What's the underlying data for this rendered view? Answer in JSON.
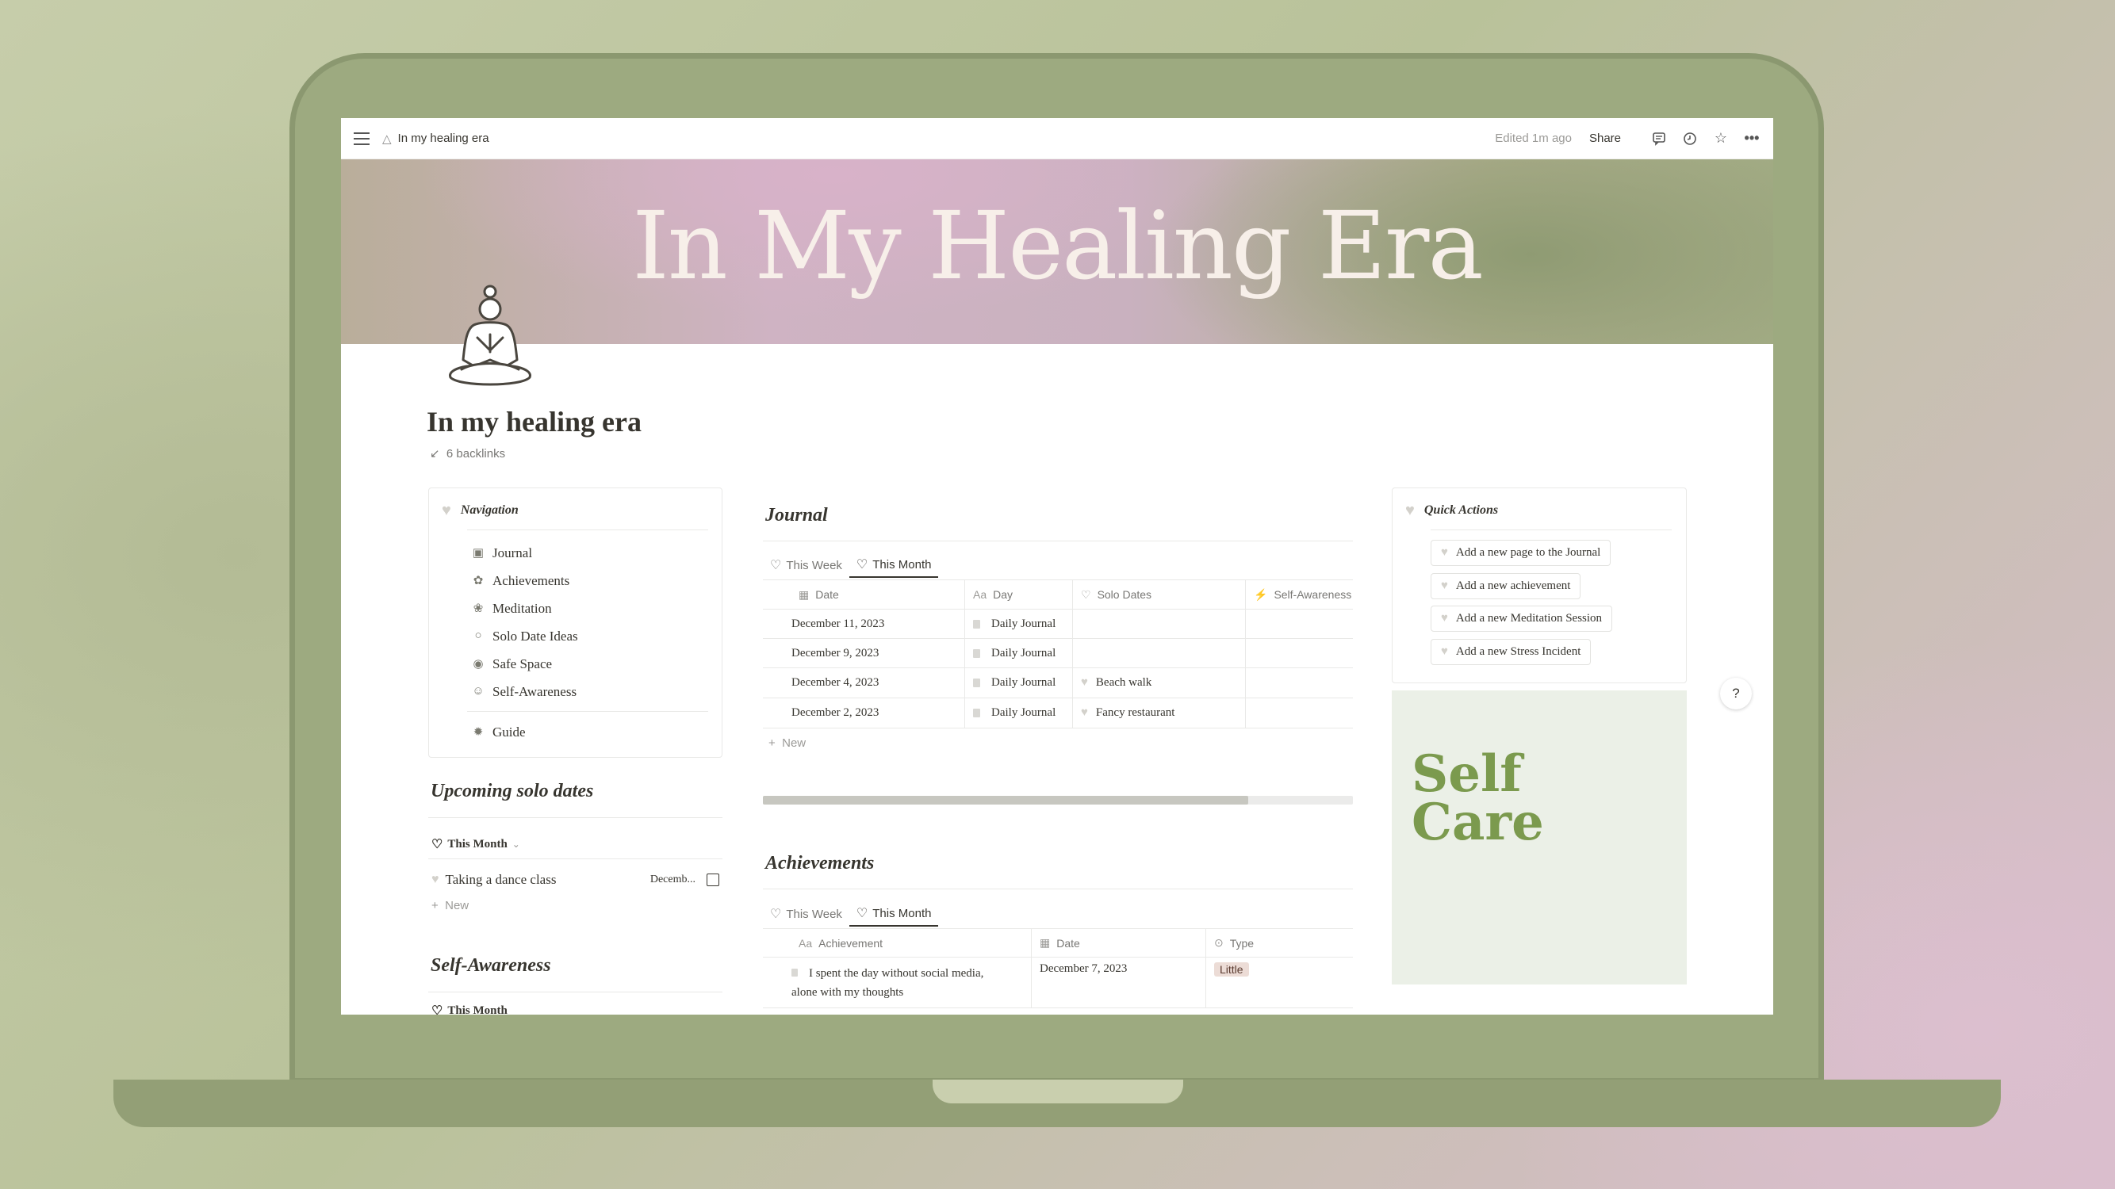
{
  "topbar": {
    "breadcrumb": "In my healing era",
    "edited": "Edited 1m ago",
    "share": "Share"
  },
  "cover": {
    "title": "In My Healing Era"
  },
  "page": {
    "title": "In my healing era",
    "backlinks": "6 backlinks"
  },
  "navigation": {
    "title": "Navigation",
    "items": [
      {
        "label": "Journal",
        "icon": "journal-icon"
      },
      {
        "label": "Achievements",
        "icon": "sprout-icon"
      },
      {
        "label": "Meditation",
        "icon": "lotus-icon"
      },
      {
        "label": "Solo Date Ideas",
        "icon": "walking-icon"
      },
      {
        "label": "Safe Space",
        "icon": "hug-icon"
      },
      {
        "label": "Self-Awareness",
        "icon": "person-icon"
      }
    ],
    "guide": "Guide"
  },
  "upcoming": {
    "title": "Upcoming solo dates",
    "tab": "This Month",
    "item": {
      "title": "Taking a dance class",
      "date": "Decemb..."
    },
    "new": "New"
  },
  "self_awareness": {
    "title": "Self-Awareness",
    "tab": "This Month"
  },
  "journal": {
    "title": "Journal",
    "tabs": [
      "This Week",
      "This Month"
    ],
    "columns": [
      "Date",
      "Day",
      "Solo Dates",
      "Self-Awareness"
    ],
    "rows": [
      {
        "date": "December 11, 2023",
        "day": "Daily Journal",
        "solo": ""
      },
      {
        "date": "December 9, 2023",
        "day": "Daily Journal",
        "solo": ""
      },
      {
        "date": "December 4, 2023",
        "day": "Daily Journal",
        "solo": "Beach walk"
      },
      {
        "date": "December 2, 2023",
        "day": "Daily Journal",
        "solo": "Fancy restaurant"
      }
    ],
    "new": "New"
  },
  "achievements": {
    "title": "Achievements",
    "tabs": [
      "This Week",
      "This Month"
    ],
    "columns": [
      "Achievement",
      "Date",
      "Type"
    ],
    "rows": [
      {
        "line1": "I spent the day without social media,",
        "line2": "alone with my thoughts",
        "date": "December 7, 2023",
        "type": "Little"
      }
    ]
  },
  "quick_actions": {
    "title": "Quick Actions",
    "buttons": [
      "Add a new page to the Journal",
      "Add a new achievement",
      "Add a new Meditation Session",
      "Add a new Stress Incident"
    ]
  },
  "self_care": {
    "line1": "Self",
    "line2": "Care"
  },
  "help": "?"
}
